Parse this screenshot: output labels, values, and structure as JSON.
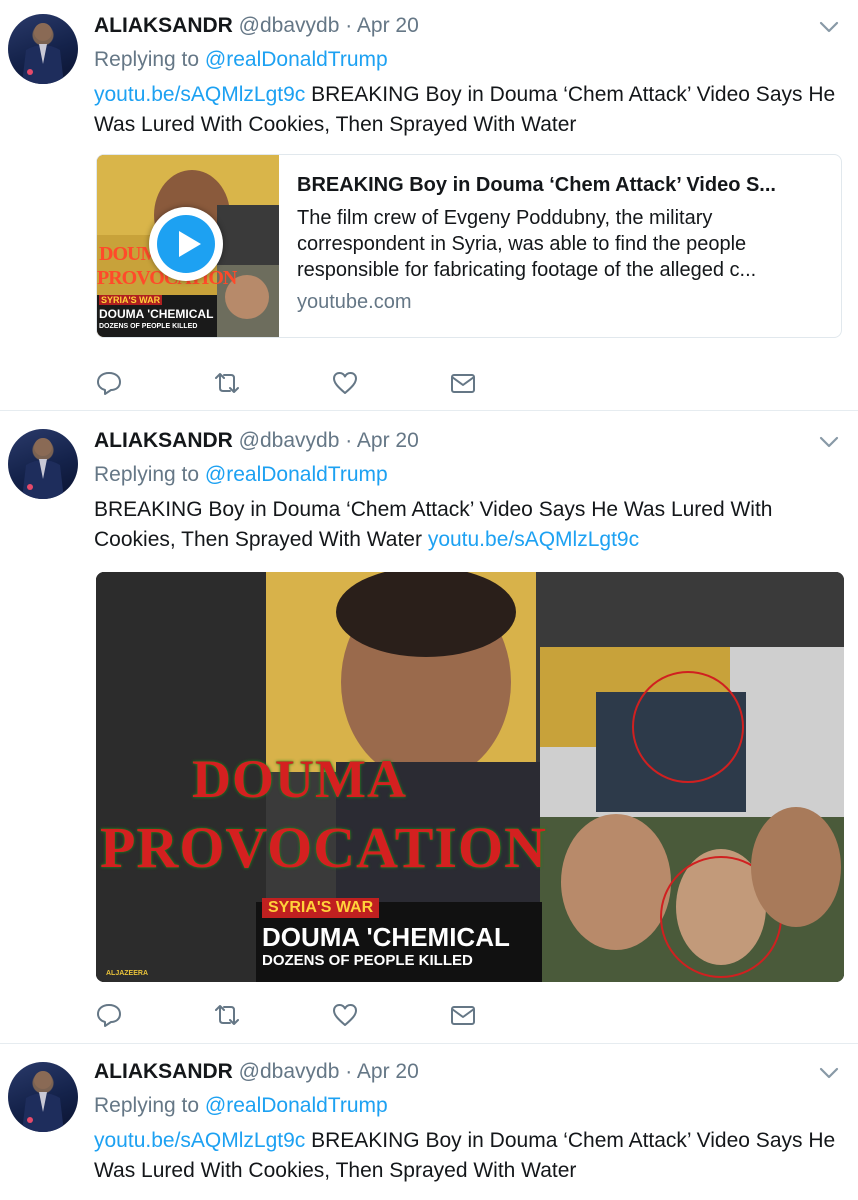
{
  "tweets": [
    {
      "name": "ALIAKSANDR",
      "handle": "@dbavydb",
      "dot": "·",
      "date": "Apr 20",
      "replying_prefix": "Replying to ",
      "replying_to": "@realDonaldTrump",
      "link": "youtu.be/sAQMlzLgt9c",
      "text": " BREAKING Boy in Douma ‘Chem Attack’ Video Says He Was Lured With Cookies, Then Sprayed With Water",
      "card": {
        "title": "BREAKING Boy in Douma ‘Chem Attack’ Video S...",
        "description": "The film crew of Evgeny Poddubny, the military correspondent in Syria, was able to find the people responsible for fabricating footage of the alleged c...",
        "domain": "youtube.com",
        "thumb_text_top": "DOUMA",
        "thumb_text_mid": "PROVOCATION",
        "thumb_text_war": "SYRIA'S WAR",
        "thumb_text_chem": "DOUMA 'CHEMICAL",
        "thumb_text_killed": "DOZENS OF PEOPLE KILLED"
      }
    },
    {
      "name": "ALIAKSANDR",
      "handle": "@dbavydb",
      "dot": "·",
      "date": "Apr 20",
      "replying_prefix": "Replying to ",
      "replying_to": "@realDonaldTrump",
      "text": "BREAKING Boy in Douma ‘Chem Attack’ Video Says He Was Lured With Cookies, Then Sprayed With Water ",
      "link": "youtu.be/sAQMlzLgt9c",
      "media": {
        "line1": "DOUMA",
        "line2": "PROVOCATION",
        "war": "SYRIA'S WAR",
        "chem": "DOUMA 'CHEMICAL",
        "killed": "DOZENS OF PEOPLE KILLED",
        "watermark": "ALJAZEERA"
      }
    },
    {
      "name": "ALIAKSANDR",
      "handle": "@dbavydb",
      "dot": "·",
      "date": "Apr 20",
      "replying_prefix": "Replying to ",
      "replying_to": "@realDonaldTrump",
      "link": "youtu.be/sAQMlzLgt9c",
      "text": " BREAKING Boy in Douma ‘Chem Attack’ Video Says He Was Lured With Cookies, Then Sprayed With Water"
    }
  ],
  "icons": {
    "reply": "reply-icon",
    "retweet": "retweet-icon",
    "like": "like-icon",
    "dm": "direct-message-icon",
    "caret": "chevron-down-icon"
  },
  "colors": {
    "link": "#1da1f2",
    "muted": "#657786",
    "text": "#14171a",
    "divider": "#e6ecf0"
  }
}
